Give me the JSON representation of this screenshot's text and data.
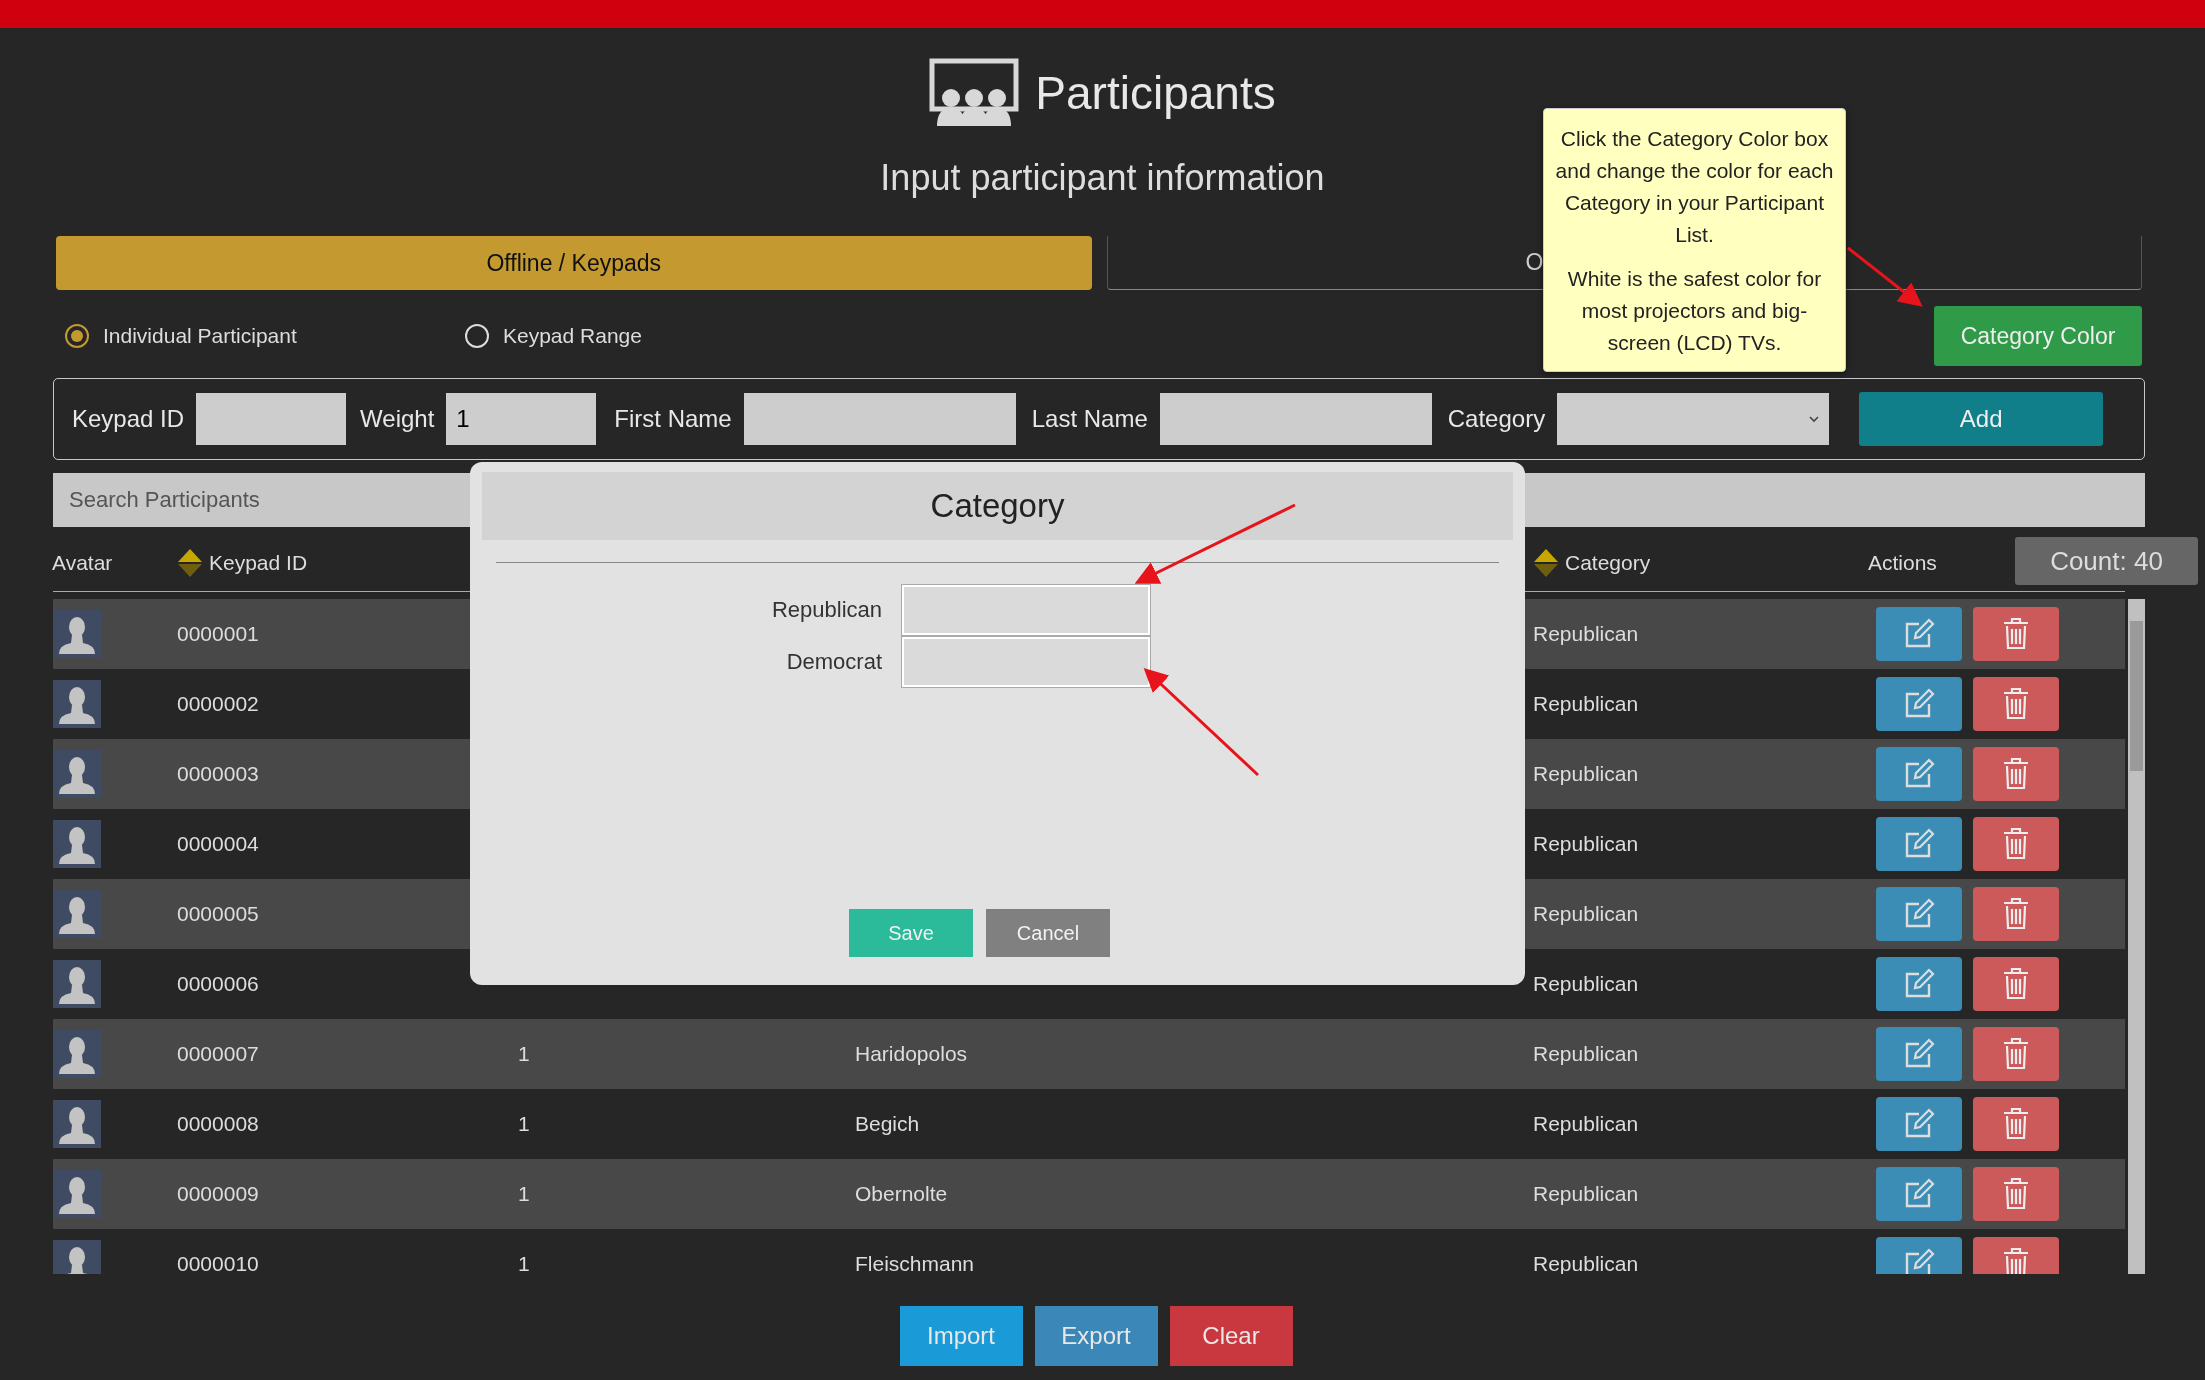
{
  "header": {
    "title": "Participants",
    "subtitle": "Input participant information"
  },
  "tabs": [
    {
      "label": "Offline / Keypads",
      "selected": true
    },
    {
      "label": "O",
      "selected": false
    }
  ],
  "modes": [
    {
      "label": "Individual Participant",
      "selected": true
    },
    {
      "label": "Keypad Range",
      "selected": false
    }
  ],
  "category_color_button": "Category Color",
  "tooltip": {
    "paragraphs": [
      "Click the Category Color box and change the color for each Category in your Participant List.",
      "White is the safest color for most projectors and big-screen (LCD) TVs."
    ]
  },
  "form": {
    "fields": [
      {
        "label": "Keypad ID",
        "kind": "text"
      },
      {
        "label": "Weight",
        "kind": "text",
        "value": "1"
      },
      {
        "label": "First Name",
        "kind": "text"
      },
      {
        "label": "Last Name",
        "kind": "text"
      },
      {
        "label": "Category",
        "kind": "select"
      }
    ],
    "add_button": "Add"
  },
  "search": {
    "placeholder": "Search Participants"
  },
  "table": {
    "columns": [
      {
        "label": "Avatar",
        "sortable": false
      },
      {
        "label": "Keypad ID",
        "sortable": true
      },
      {
        "label": "Category",
        "sortable": true
      },
      {
        "label": "Actions",
        "sortable": false
      }
    ],
    "count": "Count: 40",
    "rows": [
      {
        "keypad_id": "0000001",
        "category": "Republican"
      },
      {
        "keypad_id": "0000002",
        "category": "Republican"
      },
      {
        "keypad_id": "0000003",
        "category": "Republican"
      },
      {
        "keypad_id": "0000004",
        "category": "Republican"
      },
      {
        "keypad_id": "0000005",
        "category": "Republican"
      },
      {
        "keypad_id": "0000006",
        "category": "Republican"
      },
      {
        "keypad_id": "0000007",
        "weight": "1",
        "first_name": "Haridopolos",
        "category": "Republican"
      },
      {
        "keypad_id": "0000008",
        "weight": "1",
        "first_name": "Begich",
        "category": "Republican"
      },
      {
        "keypad_id": "0000009",
        "weight": "1",
        "first_name": "Obernolte",
        "category": "Republican"
      },
      {
        "keypad_id": "0000010",
        "weight": "1",
        "first_name": "Fleischmann",
        "category": "Republican"
      }
    ]
  },
  "modal": {
    "title": "Category",
    "fields": [
      {
        "label": "Republican"
      },
      {
        "label": "Democrat"
      }
    ],
    "buttons": [
      {
        "label": "Save",
        "kind": "primary"
      },
      {
        "label": "Cancel",
        "kind": "secondary"
      }
    ]
  },
  "footer_buttons": [
    {
      "label": "Import",
      "kind": "import"
    },
    {
      "label": "Export",
      "kind": "export"
    },
    {
      "label": "Clear",
      "kind": "clear"
    }
  ]
}
